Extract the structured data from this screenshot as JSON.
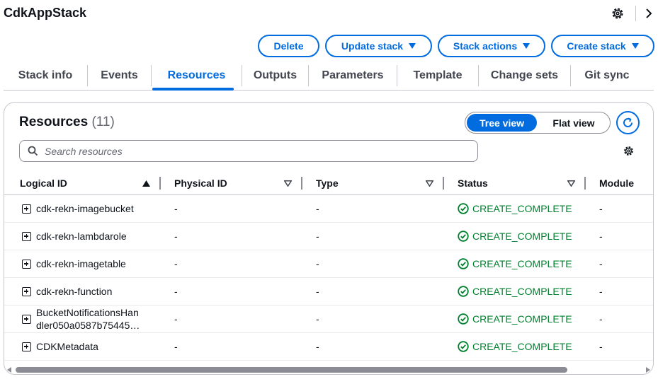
{
  "header": {
    "title": "CdkAppStack",
    "settings_icon": "gear-icon",
    "collapse_icon": "chevron-right-icon"
  },
  "actions": {
    "delete_label": "Delete",
    "update_label": "Update stack",
    "stack_actions_label": "Stack actions",
    "create_label": "Create stack"
  },
  "tabs": [
    {
      "label": "Stack info"
    },
    {
      "label": "Events"
    },
    {
      "label": "Resources"
    },
    {
      "label": "Outputs"
    },
    {
      "label": "Parameters"
    },
    {
      "label": "Template"
    },
    {
      "label": "Change sets"
    },
    {
      "label": "Git sync"
    }
  ],
  "active_tab": "Resources",
  "resources": {
    "title": "Resources",
    "count": "(11)",
    "view_toggle": {
      "tree": "Tree view",
      "flat": "Flat view",
      "selected": "Tree view"
    },
    "search_placeholder": "Search resources",
    "columns": [
      "Logical ID",
      "Physical ID",
      "Type",
      "Status",
      "Module"
    ],
    "sorted_by": "Logical ID",
    "rows": [
      {
        "logical_id": "cdk-rekn-imagebucket",
        "physical_id": "-",
        "type": "-",
        "status": "CREATE_COMPLETE",
        "module": "-"
      },
      {
        "logical_id": "cdk-rekn-lambdarole",
        "physical_id": "-",
        "type": "-",
        "status": "CREATE_COMPLETE",
        "module": "-"
      },
      {
        "logical_id": "cdk-rekn-imagetable",
        "physical_id": "-",
        "type": "-",
        "status": "CREATE_COMPLETE",
        "module": "-"
      },
      {
        "logical_id": "cdk-rekn-function",
        "physical_id": "-",
        "type": "-",
        "status": "CREATE_COMPLETE",
        "module": "-"
      },
      {
        "logical_id_line1": "BucketNotificationsHan",
        "logical_id_line2": "dler050a0587b75445…",
        "physical_id": "-",
        "type": "-",
        "status": "CREATE_COMPLETE",
        "module": "-"
      },
      {
        "logical_id": "CDKMetadata",
        "physical_id": "-",
        "type": "-",
        "status": "CREATE_COMPLETE",
        "module": "-"
      }
    ]
  },
  "colors": {
    "accent": "#006ce0",
    "success": "#00802f",
    "text": "#0f141a",
    "border": "#c6c6cd"
  }
}
